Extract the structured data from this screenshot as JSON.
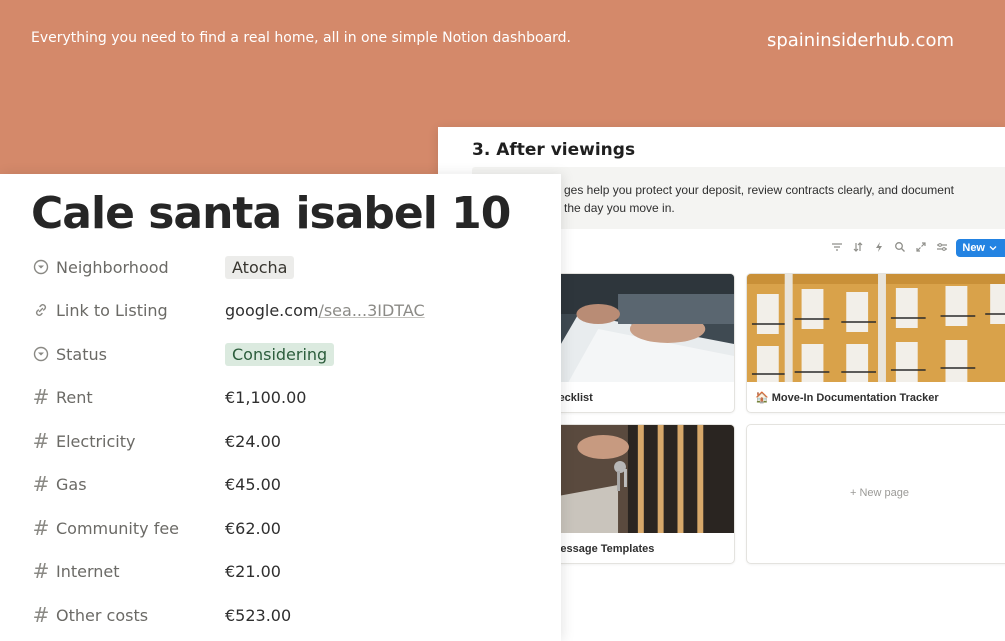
{
  "banner": {
    "tagline": "Everything you need to find a real home, all in one simple Notion dashboard.",
    "site": "spaininsiderhub.com"
  },
  "after_viewings": {
    "title": "3. After viewings",
    "callout_line1": "ges help you protect your deposit, review contracts clearly, and document",
    "callout_line2": "the day you move in.",
    "toolbar": {
      "icons": [
        "filter-icon",
        "sort-icon",
        "automation-icon",
        "search-icon",
        "expand-icon",
        "settings-icon"
      ],
      "new_label": "New"
    },
    "cards": [
      {
        "title": "view Checklist"
      },
      {
        "title": "🏠 Move-In Documentation Tracker"
      },
      {
        "title": "Agent Message Templates"
      }
    ],
    "new_page_label": "+ New page"
  },
  "property": {
    "title": "Cale santa isabel 10",
    "rows": [
      {
        "key": "Neighborhood",
        "value": "Atocha"
      },
      {
        "key": "Link to Listing",
        "domain": "google.com",
        "path": "/sea...3IDTAC"
      },
      {
        "key": "Status",
        "value": "Considering"
      },
      {
        "key": "Rent",
        "value": "€1,100.00"
      },
      {
        "key": "Electricity",
        "value": "€24.00"
      },
      {
        "key": "Gas",
        "value": "€45.00"
      },
      {
        "key": "Community fee",
        "value": "€62.00"
      },
      {
        "key": "Internet",
        "value": "€21.00"
      },
      {
        "key": "Other costs",
        "value": "€523.00"
      }
    ]
  },
  "colors": {
    "banner_bg": "#d4896a",
    "accent_blue": "#2383e2",
    "status_green_bg": "#dbeadf",
    "tag_grey_bg": "#ececea"
  }
}
